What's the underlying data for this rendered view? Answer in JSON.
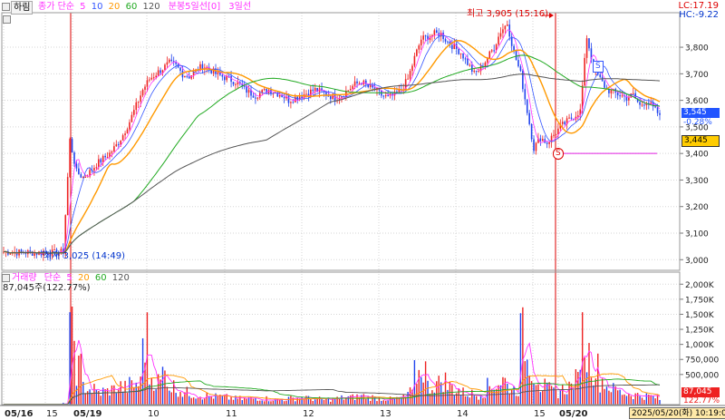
{
  "price_legend": {
    "btn": "하림",
    "ma_title": "종가 단순",
    "ma": [
      {
        "label": "5",
        "color": "#ff33ff"
      },
      {
        "label": "10",
        "color": "#3355ff"
      },
      {
        "label": "20",
        "color": "#ff9900"
      },
      {
        "label": "60",
        "color": "#22aa22"
      },
      {
        "label": "120",
        "color": "#555555"
      }
    ],
    "extra": "분봉5일선[0]",
    "extra2": "3일선"
  },
  "volume_legend": {
    "title": "거래량",
    "ma_title": "단순",
    "ma": [
      {
        "label": "5",
        "color": "#ff33ff"
      },
      {
        "label": "20",
        "color": "#ff9900"
      },
      {
        "label": "60",
        "color": "#22aa22"
      },
      {
        "label": "120",
        "color": "#555555"
      }
    ],
    "current": "87,045주(122.77%)"
  },
  "top_right": {
    "lc": "LC:17.19",
    "hc": "HC:-9.22"
  },
  "price_tags": {
    "current_price": "3,545",
    "current_change": "-0.28%",
    "ref_price": "3,445",
    "vol_value": "87,045",
    "vol_pct": "122.77%"
  },
  "annotations": {
    "high": "최고 3,905 (15:16)",
    "low": "최저 3,025 (14:49)",
    "marker_s1": "S",
    "marker_s2": "S"
  },
  "x_axis": {
    "ticks": [
      "05/16",
      "15",
      "05/19",
      "10",
      "11",
      "12",
      "13",
      "14",
      "15",
      "05/20"
    ],
    "cursor_time": "2025/05/20(화) 10:19:00"
  },
  "chart_data": [
    {
      "type": "candlestick",
      "title": "하림",
      "y_ticks": [
        3000,
        3100,
        3200,
        3300,
        3400,
        3500,
        3600,
        3700,
        3800
      ],
      "y_tick_labels": [
        "3,000",
        "3,100",
        "3,200",
        "3,300",
        "3,400",
        "3,500",
        "3,600",
        "3,700",
        "3,800"
      ],
      "ylim": [
        2960,
        3930
      ],
      "grid": true,
      "legend": "top-left",
      "series_close_path": [
        3030,
        3030,
        3028,
        3027,
        3027,
        3026,
        3026,
        3026,
        3025,
        3030,
        3450,
        3330,
        3310,
        3330,
        3360,
        3380,
        3400,
        3430,
        3470,
        3520,
        3580,
        3640,
        3680,
        3700,
        3720,
        3740,
        3730,
        3700,
        3690,
        3710,
        3730,
        3720,
        3700,
        3690,
        3680,
        3670,
        3650,
        3630,
        3620,
        3630,
        3640,
        3630,
        3620,
        3600,
        3610,
        3620,
        3630,
        3640,
        3630,
        3620,
        3610,
        3620,
        3640,
        3660,
        3670,
        3650,
        3640,
        3620,
        3610,
        3620,
        3640,
        3680,
        3760,
        3830,
        3840,
        3850,
        3850,
        3820,
        3800,
        3780,
        3740,
        3700,
        3720,
        3760,
        3800,
        3860,
        3890,
        3780,
        3700,
        3560,
        3420,
        3460,
        3440,
        3470,
        3500,
        3520,
        3540,
        3560,
        3840,
        3720,
        3680,
        3640,
        3630,
        3620,
        3610,
        3620,
        3580,
        3600,
        3570,
        3545
      ],
      "high": {
        "value": 3905,
        "time": "15:16"
      },
      "low": {
        "value": 3025,
        "time": "14:49"
      },
      "ref_line": 3400,
      "moving_averages": [
        "5",
        "10",
        "20",
        "60",
        "120"
      ]
    },
    {
      "type": "bar",
      "title": "거래량",
      "y_ticks": [
        500000,
        750000,
        1000000,
        1250000,
        1500000,
        1750000,
        2000000
      ],
      "y_tick_labels": [
        "500,000",
        "750,000",
        "1,000K",
        "1,250K",
        "1,500K",
        "1,750K",
        "2,000K"
      ],
      "ylim": [
        0,
        2200000
      ],
      "grid": true,
      "volume_path": [
        5000,
        5000,
        5000,
        5000,
        5000,
        5000,
        5000,
        5000,
        5000,
        20000,
        1100000,
        600000,
        300000,
        250000,
        200000,
        220000,
        250000,
        300000,
        280000,
        320000,
        350000,
        1100000,
        450000,
        380000,
        520000,
        300000,
        250000,
        200000,
        180000,
        160000,
        150000,
        140000,
        130000,
        120000,
        110000,
        100000,
        90000,
        100000,
        110000,
        100000,
        90000,
        80000,
        90000,
        100000,
        110000,
        120000,
        100000,
        90000,
        80000,
        90000,
        100000,
        110000,
        120000,
        130000,
        140000,
        120000,
        110000,
        100000,
        90000,
        100000,
        120000,
        200000,
        500000,
        600000,
        300000,
        350000,
        400000,
        300000,
        250000,
        200000,
        180000,
        160000,
        200000,
        300000,
        350000,
        400000,
        300000,
        250000,
        1100000,
        700000,
        500000,
        300000,
        250000,
        200000,
        250000,
        300000,
        400000,
        1150000,
        800000,
        600000,
        400000,
        300000,
        250000,
        200000,
        180000,
        160000,
        150000,
        140000,
        120000,
        87045
      ]
    }
  ]
}
